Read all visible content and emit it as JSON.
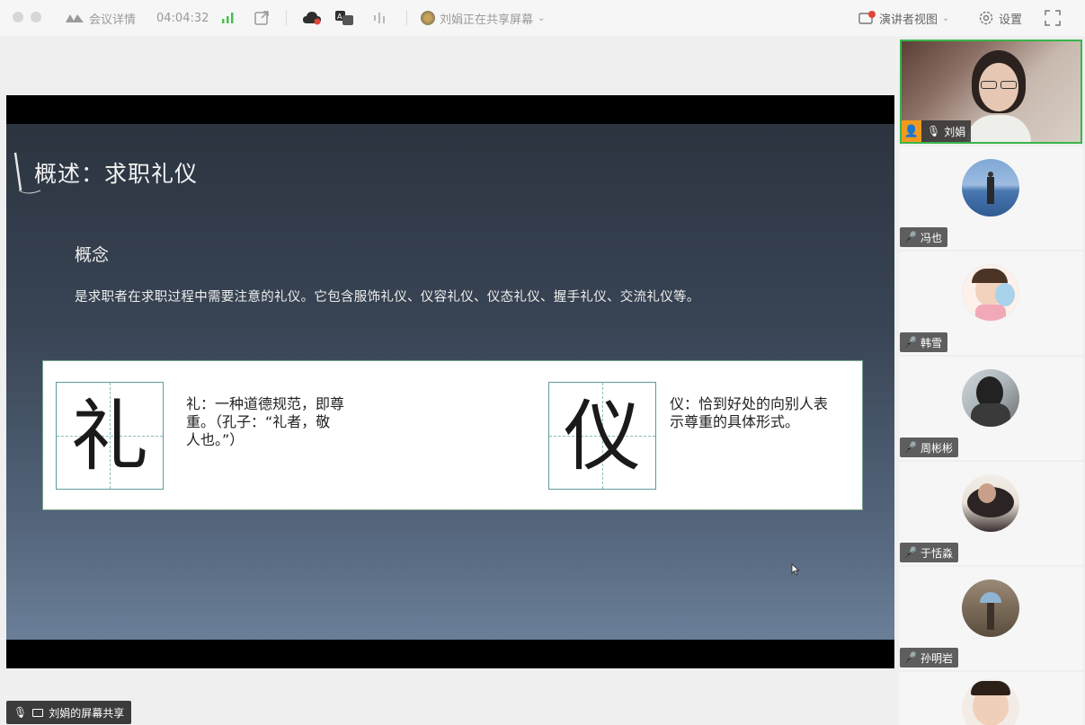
{
  "topbar": {
    "app_label": "会议详情",
    "timer": "04:04:32",
    "sharing_status": "刘娟正在共享屏幕",
    "presenter_view_label": "演讲者视图",
    "settings_label": "设置"
  },
  "slide": {
    "title": "概述：求职礼仪",
    "subtitle": "概念",
    "description": "是求职者在求职过程中需要注意的礼仪。它包含服饰礼仪、仪容礼仪、仪态礼仪、握手礼仪、交流礼仪等。",
    "card": {
      "left_char": "礼",
      "left_text_lines": [
        "礼：一种道德规范，即尊",
        "重。（孔子：“礼者，敬",
        "人也。”）"
      ],
      "right_char": "仪",
      "right_text_lines": [
        "仪：恰到好处的向别人表",
        "示尊重的具体形式。"
      ]
    }
  },
  "participants": {
    "featured": {
      "name": "刘娟"
    },
    "list": [
      {
        "name": "冯也"
      },
      {
        "name": "韩雪"
      },
      {
        "name": "周彬彬"
      },
      {
        "name": "于恬淼"
      },
      {
        "name": "孙明岩"
      },
      {
        "name": ""
      }
    ]
  },
  "bottom_tag": "刘娟的屏幕共享",
  "colors": {
    "active_border": "#39b54a",
    "mic_muted": "#e76a5b",
    "signal": "#48c04e"
  }
}
